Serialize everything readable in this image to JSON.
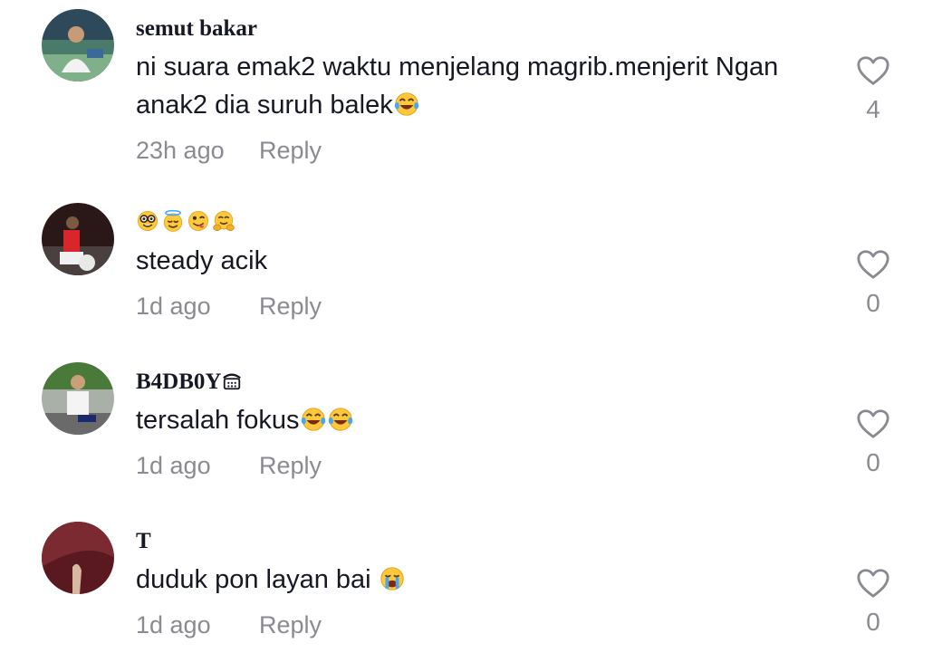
{
  "comments": [
    {
      "username": "semut bakar",
      "text": "ni suara emak2 waktu menjelang magrib.menjerit Ngan anak2 dia suruh balek",
      "time": "23h ago",
      "reply": "Reply",
      "likes": "4",
      "trailing_emoji": [
        "face-with-tears-of-joy"
      ]
    },
    {
      "username_emojis": [
        "nerd-face",
        "smiling-face-with-halo",
        "winking-face-with-tongue",
        "hugging-face"
      ],
      "text": "steady acik",
      "time": "1d ago",
      "reply": "Reply",
      "likes": "0"
    },
    {
      "username": "B4DB0Y",
      "username_suffix_icon": "telephone-icon",
      "text": "tersalah fokus",
      "time": "1d ago",
      "reply": "Reply",
      "likes": "0",
      "trailing_emoji": [
        "face-with-tears-of-joy",
        "face-with-tears-of-joy"
      ]
    },
    {
      "username": "T",
      "text": "duduk pon layan bai ",
      "time": "1d ago",
      "reply": "Reply",
      "likes": "0",
      "trailing_emoji": [
        "loudly-crying-face"
      ]
    }
  ],
  "colors": {
    "text": "#161823",
    "meta": "#8a8b91",
    "emoji_yellow": "#ffc93a",
    "tear_blue": "#46a8f0"
  }
}
